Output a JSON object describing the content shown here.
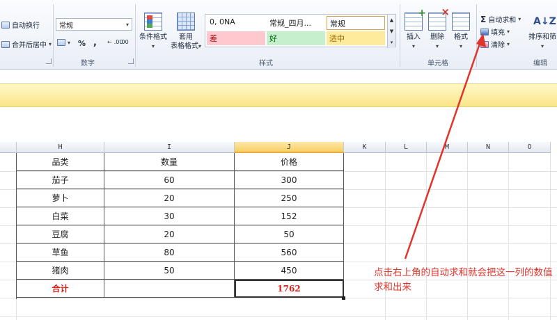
{
  "ribbon": {
    "alignment": {
      "wrap_text": "自动换行",
      "merge_center": "合并后居中"
    },
    "number": {
      "format": "常规",
      "percent": "%",
      "comma": ",",
      "inc_decimal": ".00",
      "dec_decimal": ".00",
      "label": "数字"
    },
    "styles": {
      "conditional_format": "条件格式",
      "format_table_line1": "套用",
      "format_table_line2": "表格格式",
      "gallery": [
        {
          "text": "0, 0NA",
          "bg": "#ffffff",
          "color": "#222222"
        },
        {
          "text": "常规_四月...",
          "bg": "#ffffff",
          "color": "#222222"
        },
        {
          "text": "常规",
          "bg": "#ffffff",
          "color": "#222222"
        },
        {
          "text": "差",
          "bg": "#ffc7ce",
          "color": "#9c0006"
        },
        {
          "text": "好",
          "bg": "#c6efce",
          "color": "#006100"
        },
        {
          "text": "适中",
          "bg": "#ffeb9c",
          "color": "#9c6500"
        }
      ],
      "label": "样式"
    },
    "cells": {
      "insert": "插入",
      "delete": "删除",
      "format": "格式",
      "label": "单元格"
    },
    "editing": {
      "autosum": "自动求和",
      "fill": "填充",
      "clear": "清除",
      "sort_filter": "排序和筛",
      "label": "编辑"
    }
  },
  "grid": {
    "columns": [
      "H",
      "I",
      "J",
      "K",
      "L",
      "M",
      "N",
      "O"
    ],
    "selected_column": "J",
    "headers": [
      "品类",
      "数量",
      "价格"
    ],
    "rows": [
      [
        "茄子",
        "60",
        "300"
      ],
      [
        "萝卜",
        "20",
        "250"
      ],
      [
        "白菜",
        "30",
        "152"
      ],
      [
        "豆腐",
        "20",
        "50"
      ],
      [
        "草鱼",
        "80",
        "560"
      ],
      [
        "猪肉",
        "50",
        "450"
      ]
    ],
    "total": {
      "label": "合计",
      "quantity": "",
      "price": "1762"
    }
  },
  "annotation": {
    "text": "点击右上角的自动求和就会把这一列的数值求和出来",
    "color": "#e0332a"
  }
}
